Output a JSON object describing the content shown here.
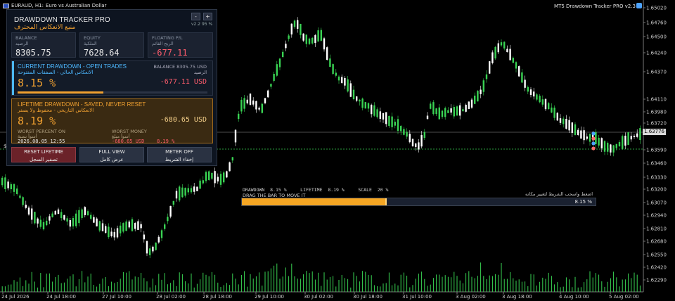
{
  "symbol": {
    "label": "EURAUD, H1:",
    "desc": "Euro vs Australian Dollar"
  },
  "ea_name": "MT5 Drawdown Tracker PRO v2.3",
  "price_tag": {
    "current": "1.63776",
    "left_marker": "$"
  },
  "panel": {
    "title": "DRAWDOWN TRACKER PRO",
    "subtitle": "منبع الانعكاس المحترف",
    "version": "v2.2  95 %",
    "minus": "-",
    "plus": "+",
    "balance": {
      "label": "BALANCE",
      "label_ar": "الرصيد",
      "value": "8305.75"
    },
    "equity": {
      "label": "EQUITY",
      "label_ar": "الملكية",
      "value": "7628.64"
    },
    "floating": {
      "label": "FLOATING P/L",
      "label_ar": "الربح القائم",
      "value": "-677.11"
    },
    "current": {
      "title": "CURRENT DRAWDOWN - OPEN TRADES",
      "title_ar": "الانعكاس الحالي - الصفقات المفتوحة",
      "balance_label": "BALANCE   8305.75 USD",
      "balance_label_ar": "الرصيد",
      "percent": "8.15 %",
      "money": "-677.11 USD",
      "progress": 0.45
    },
    "lifetime": {
      "title": "LIFETIME DRAWDOWN - SAVED, NEVER RESET",
      "title_ar": "الانعكاس التاريخي - محفوظ ولا يصفر",
      "percent": "8.19 %",
      "money": "-680.65 USD",
      "worst_pct_label": "WORST PERCENT ON",
      "worst_pct_label_ar": "أسوأ نسبة",
      "worst_pct_value": "2026.08.05 12:55",
      "worst_money_label": "WORST MONEY",
      "worst_money_label_ar": "أسوأ مبلغ",
      "worst_money_value": "-680.65 USD",
      "worst_money_pct": "8.19 %"
    },
    "buttons": {
      "reset": {
        "label": "RESET LIFETIME",
        "label_ar": "تصفير السجل"
      },
      "full": {
        "label": "FULL VIEW",
        "label_ar": "عرض كامل"
      },
      "meter": {
        "label": "METER OFF",
        "label_ar": "إخفاء الشريط"
      }
    }
  },
  "meter": {
    "row": "DRAWDOWN  8.15 %     LIFETIME  8.19 %     SCALE  20 %",
    "hint": "DRAG THE BAR TO MOVE IT",
    "hint_ar": "اضغط واسحب الشريط لتغيير مكانه",
    "pct": "8.15 %",
    "fill": 0.41
  },
  "price_axis": [
    "1.65020",
    "1.64760",
    "1.64500",
    "1.64240",
    "1.64370",
    "1.64110",
    "1.63980",
    "1.63720",
    "1.63590",
    "1.63460",
    "1.63330",
    "1.63200",
    "1.63070",
    "1.62940",
    "1.62810",
    "1.62680",
    "1.62550",
    "1.62420",
    "1.62290"
  ],
  "time_axis": [
    "24 Jul 2026",
    "24 Jul 18:00",
    "27 Jul 10:00",
    "28 Jul 02:00",
    "28 Jul 18:00",
    "29 Jul 10:00",
    "30 Jul 02:00",
    "30 Jul 18:00",
    "31 Jul 10:00",
    "3 Aug 02:00",
    "3 Aug 18:00",
    "4 Aug 10:00",
    "5 Aug 02:00"
  ],
  "colors": {
    "bull": "#39d353",
    "bear": "#ffffff",
    "accent": "#f0a030",
    "loss": "#ff5d6c",
    "current_section": "#4db8ff"
  }
}
